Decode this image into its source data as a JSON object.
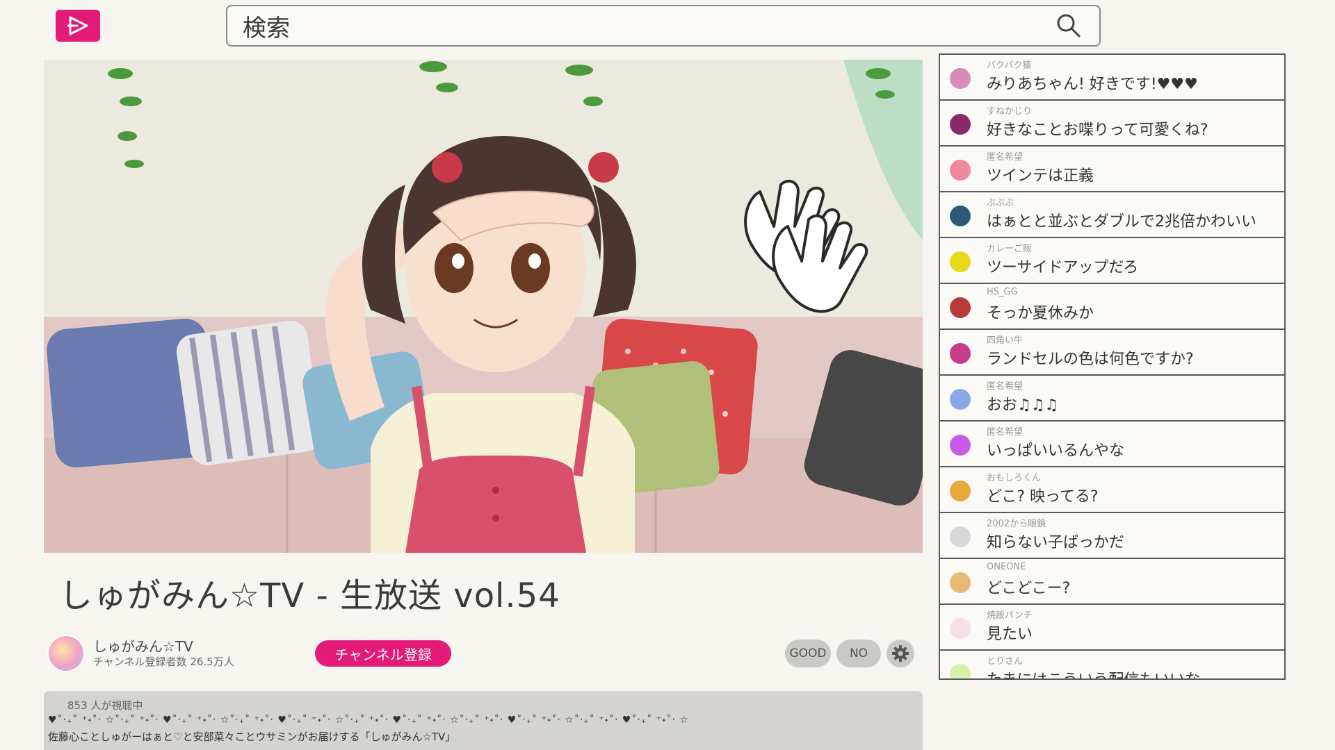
{
  "search": {
    "placeholder": "検索"
  },
  "video": {
    "title": "しゅがみん☆TV - 生放送 vol.54"
  },
  "channel": {
    "name": "しゅがみん☆TV",
    "subscribers": "チャンネル登録者数 26.5万人",
    "subscribe_label": "チャンネル登録"
  },
  "actions": {
    "good_label": "GOOD",
    "no_label": "NO"
  },
  "description": {
    "viewers": "853 人が視聴中",
    "decoration": "♥˚‧₊˚ ⁺˖˚‧ ☆˚‧₊˚ ⁺˖˚‧ ♥˚‧₊˚ ⁺˖˚‧ ☆˚‧₊˚ ⁺˖˚‧ ♥˚‧₊˚ ⁺˖˚‧ ☆˚‧₊˚ ⁺˖˚‧ ♥˚‧₊˚ ⁺˖˚‧ ☆˚‧₊˚ ⁺˖˚‧ ♥˚‧₊˚ ⁺˖˚‧ ☆˚‧₊˚ ⁺˖˚‧ ♥˚‧₊˚ ⁺˖˚‧ ☆",
    "text": "佐藤心ことしゅがーはぁと♡と安部菜々ことウサミンがお届けする「しゅがみん☆TV」"
  },
  "chat": [
    {
      "user": "バクバク猿",
      "text": "みりあちゃん! 好きです!♥♥♥",
      "color": "#d88ab8"
    },
    {
      "user": "すねかじり",
      "text": "好きなことお喋りって可愛くね?",
      "color": "#8a2a6a"
    },
    {
      "user": "匿名希望",
      "text": "ツインテは正義",
      "color": "#f08a9a"
    },
    {
      "user": "ぶぶぶ",
      "text": "はぁとと並ぶとダブルで2兆倍かわいい",
      "color": "#2e5a7a"
    },
    {
      "user": "カレーご飯",
      "text": "ツーサイドアップだろ",
      "color": "#e8d81a"
    },
    {
      "user": "HS_GG",
      "text": "そっか夏休みか",
      "color": "#b83a3a"
    },
    {
      "user": "四角い牛",
      "text": "ランドセルの色は何色ですか?",
      "color": "#c83a8a"
    },
    {
      "user": "匿名希望",
      "text": "おお♫♫♫",
      "color": "#8aa8e8"
    },
    {
      "user": "匿名希望",
      "text": "いっぱいいるんやな",
      "color": "#c85ae8"
    },
    {
      "user": "おもしろくん",
      "text": "どこ? 映ってる?",
      "color": "#e8a83a"
    },
    {
      "user": "2002から眼鏡",
      "text": "知らない子ばっかだ",
      "color": "#d8d8d8"
    },
    {
      "user": "ONEONE",
      "text": "どこどこー?",
      "color": "#e8b878"
    },
    {
      "user": "焼飯パンチ",
      "text": "見たい",
      "color": "#f8e0e8"
    },
    {
      "user": "とりさん",
      "text": "たまにはこういう配信もいいな",
      "color": "#d8f0a8"
    }
  ]
}
